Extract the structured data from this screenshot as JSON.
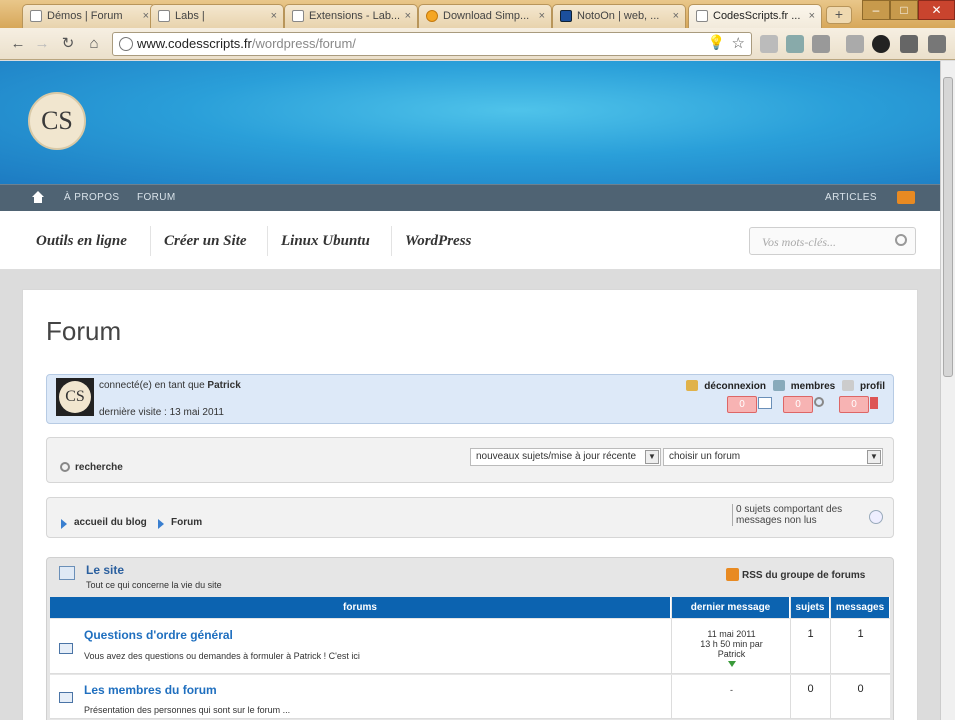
{
  "browser": {
    "tabs": [
      {
        "label": "Démos | Forum",
        "icon": "page-icon"
      },
      {
        "label": "Labs |",
        "icon": "page-icon"
      },
      {
        "label": "Extensions - Lab...",
        "icon": "page-icon"
      },
      {
        "label": "Download Simp...",
        "icon": "mozilla-icon"
      },
      {
        "label": "NotoOn | web, ...",
        "icon": "n-icon"
      },
      {
        "label": "CodesScripts.fr ...",
        "icon": "cs-icon"
      }
    ],
    "url_host": "www.codesscripts.fr",
    "url_path": "/wordpress/forum/"
  },
  "site": {
    "logo_text": "CS",
    "topnav": {
      "items": [
        "À PROPOS",
        "FORUM"
      ],
      "right": "ARTICLES"
    },
    "categories": [
      "Outils en ligne",
      "Créer un Site",
      "Linux Ubuntu",
      "WordPress"
    ],
    "search_placeholder": "Vos mots-clés...",
    "accent": "#1d7bc2"
  },
  "forum": {
    "title": "Forum",
    "user": {
      "connected_prefix": "connecté(e) en tant que",
      "name": "Patrick",
      "last_visit": "dernière visite : 13 mai 2011",
      "links": [
        "déconnexion",
        "membres",
        "profil"
      ],
      "counts": [
        "0",
        "0",
        "0"
      ]
    },
    "search": {
      "label": "recherche",
      "sort_value": "nouveaux sujets/mise à jour récente",
      "forum_select": "choisir un forum"
    },
    "breadcrumb": [
      "accueil du blog",
      "Forum"
    ],
    "unread_text": "0 sujets comportant des messages non lus",
    "group": {
      "title": "Le site",
      "desc": "Tout ce qui concerne la vie du site",
      "rss": "RSS du groupe de forums",
      "headers": [
        "forums",
        "dernier message",
        "sujets",
        "messages"
      ],
      "rows": [
        {
          "name": "Questions d'ordre général",
          "desc": "Vous avez des questions ou demandes à formuler à Patrick ! C'est ici",
          "last_date": "11 mai 2011",
          "last_ago": "13 h 50 min par",
          "last_user": "Patrick",
          "topics": "1",
          "posts": "1"
        },
        {
          "name": "Les membres du forum",
          "desc": "Présentation des personnes qui sont sur le forum ...",
          "last_date": "-",
          "topics": "0",
          "posts": "0"
        }
      ]
    }
  }
}
